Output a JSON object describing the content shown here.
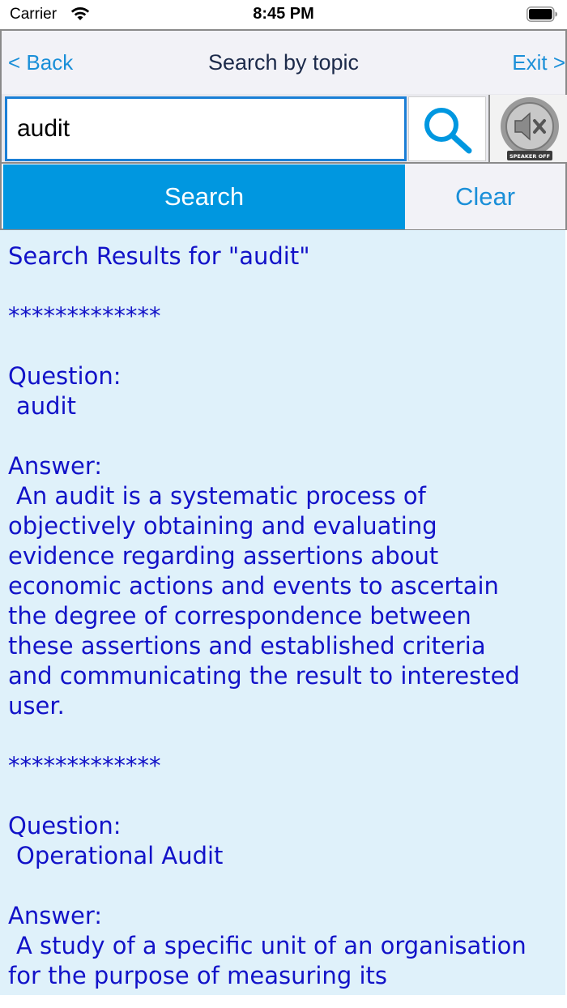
{
  "status_bar": {
    "carrier": "Carrier",
    "time": "8:45 PM"
  },
  "nav": {
    "back_label": "< Back",
    "title": "Search by topic",
    "exit_label": "Exit >"
  },
  "search": {
    "query": "audit",
    "speaker_label": "SPEAKER OFF"
  },
  "buttons": {
    "search_label": "Search",
    "clear_label": "Clear"
  },
  "results": {
    "header": "Search Results for  \"audit\"",
    "separator": "*************",
    "entries": [
      {
        "question_label": "Question:",
        "question": "audit",
        "answer_label": "Answer:",
        "answer_lines": [
          "An audit is a systematic process of",
          "objectively obtaining and evaluating",
          "evidence regarding assertions about",
          "economic actions and events to ascertain",
          "the degree of correspondence between",
          "these assertions and established criteria",
          "and communicating the result to interested",
          "user."
        ]
      },
      {
        "question_label": "Question:",
        "question": "Operational Audit",
        "answer_label": "Answer:",
        "answer_lines": [
          "A study of a specific unit of an organisation",
          "for the purpose of measuring its"
        ]
      }
    ]
  },
  "colors": {
    "accent": "#0097e0",
    "link": "#1a8fd8",
    "result_text": "#1212c8",
    "result_bg": "#dff1fa"
  }
}
